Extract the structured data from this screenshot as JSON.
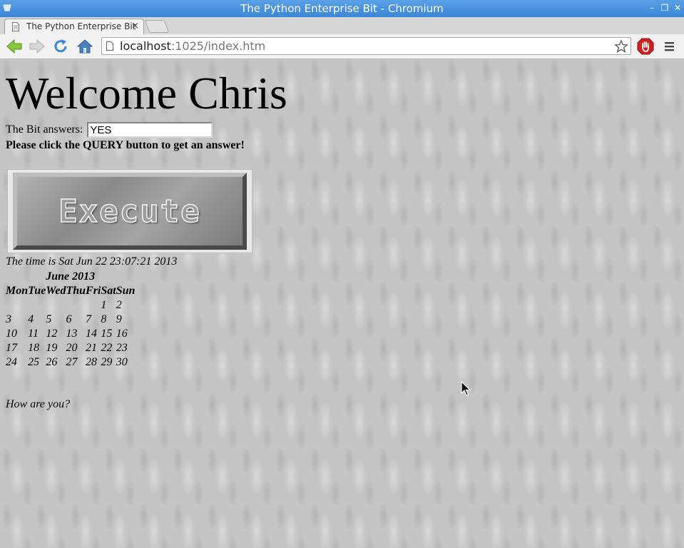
{
  "window": {
    "title": "The Python Enterprise Bit - Chromium",
    "controls": [
      "minimize",
      "restore",
      "close"
    ]
  },
  "tabs": [
    {
      "title": "The Python Enterprise Bit",
      "close": "×",
      "active": true
    }
  ],
  "toolbar": {
    "url_host": "localhost",
    "url_rest": ":1025/index.htm",
    "icons": [
      "back-icon",
      "forward-icon",
      "reload-icon",
      "home-icon",
      "star-icon",
      "adblock-icon",
      "menu-icon"
    ]
  },
  "page": {
    "heading": "Welcome Chris",
    "answer_label": "The Bit answers:",
    "answer_value": "YES",
    "instruction": "Please click the QUERY button to get an answer!",
    "execute_label": "Execute",
    "time_line": "The time is Sat Jun 22 23:07:21 2013",
    "calendar": {
      "caption": "June 2013",
      "headers": [
        "Mon",
        "Tue",
        "Wed",
        "Thu",
        "Fri",
        "Sat",
        "Sun"
      ],
      "weeks": [
        [
          "",
          "",
          "",
          "",
          "",
          "1",
          "2"
        ],
        [
          "3",
          "4",
          "5",
          "6",
          "7",
          "8",
          "9"
        ],
        [
          "10",
          "11",
          "12",
          "13",
          "14",
          "15",
          "16"
        ],
        [
          "17",
          "18",
          "19",
          "20",
          "21",
          "22",
          "23"
        ],
        [
          "24",
          "25",
          "26",
          "27",
          "28",
          "29",
          "30"
        ]
      ]
    },
    "closing": "How are you?"
  },
  "colors": {
    "titlebar": "#3b86d8",
    "page_background": "#c4c4c4",
    "adblock": "#d22020"
  }
}
